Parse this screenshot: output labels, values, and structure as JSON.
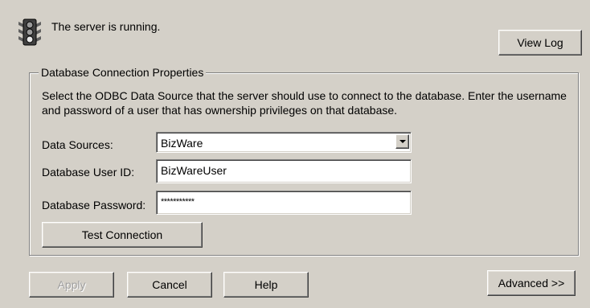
{
  "status": {
    "icon": "traffic-light-icon",
    "text": "The server is running."
  },
  "view_log_label": "View Log",
  "group": {
    "title": "Database Connection Properties",
    "description": "Select the ODBC Data Source that the server should use to connect to the database. Enter the username and password of a user that has ownership privileges on that database."
  },
  "fields": {
    "data_sources_label": "Data Sources:",
    "data_sources_value": "BizWare",
    "user_id_label": "Database User ID:",
    "user_id_value": "BizWareUser",
    "password_label": "Database Password:",
    "password_value": "***********"
  },
  "test_connection_label": "Test Connection",
  "footer": {
    "apply_label": "Apply",
    "cancel_label": "Cancel",
    "help_label": "Help",
    "advanced_label": "Advanced >>"
  }
}
